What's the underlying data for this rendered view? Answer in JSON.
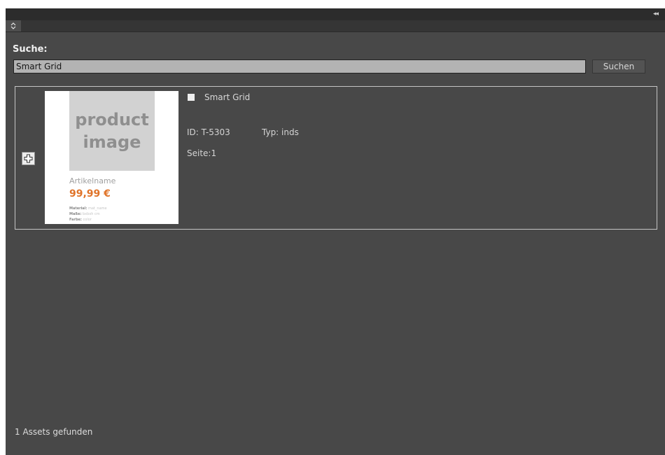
{
  "header": {
    "collapse_icon": "double-chevron-left-icon"
  },
  "tabbar": {
    "tab_icon": "up-down-arrows-icon"
  },
  "search": {
    "label": "Suche:",
    "value": "Smart Grid",
    "button_label": "Suchen"
  },
  "results": [
    {
      "title": "Smart Grid",
      "id_text": "ID: T-5303",
      "type_text": "Typ: inds",
      "page_text": "Seite:1",
      "checked": false,
      "thumbnail": {
        "image_placeholder_line1": "product",
        "image_placeholder_line2": "image",
        "article_name": "Artikelname",
        "price": "99,99 €",
        "material_label": "Material:",
        "material_value": "mat_name",
        "size_label": "Maße:",
        "size_value": "bxbxh cm",
        "color_label": "Farbe:",
        "color_value": "color"
      }
    }
  ],
  "footer": {
    "count_text": "1 Assets gefunden"
  },
  "colors": {
    "panel_bg": "#484848",
    "price_accent": "#e0742a",
    "input_bg": "#b3b3b3"
  }
}
